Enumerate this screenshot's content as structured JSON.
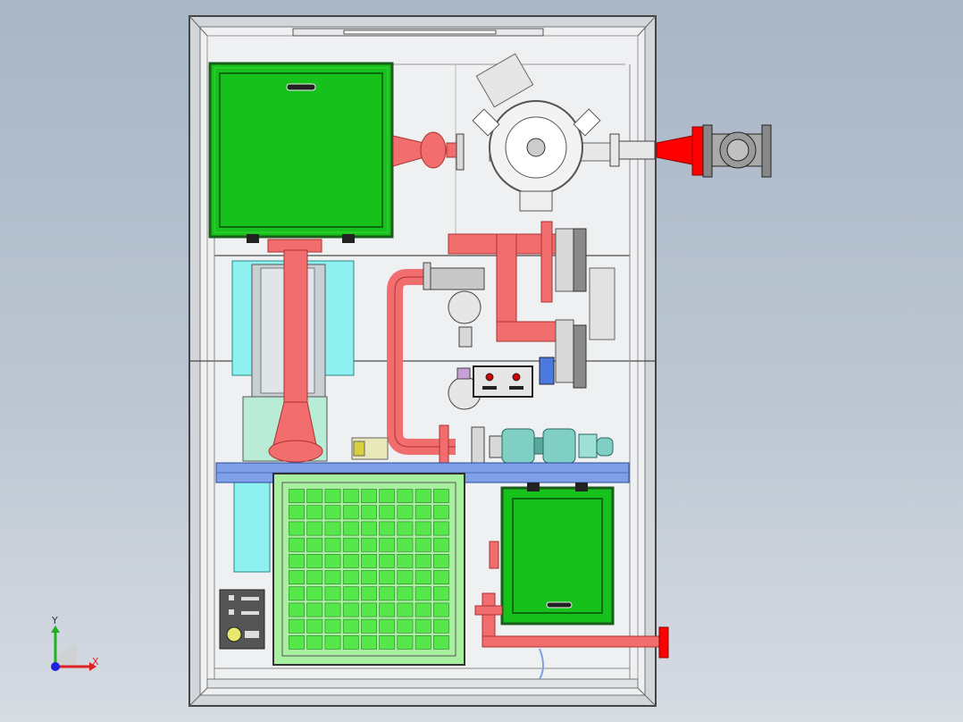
{
  "viewport": {
    "background_top": "#a9b6c6",
    "background_bottom": "#d7dce3"
  },
  "colors": {
    "cabinet_frame": "#cfd3d8",
    "cabinet_panel": "#eef0f2",
    "enclosure_green": "#16c11b",
    "enclosure_border": "#1f7a1f",
    "pipe_red": "#f26d6d",
    "pipe_hot": "#ff0000",
    "cooling_cyan": "#8ff0f0",
    "teal_pump": "#7fcfc4",
    "support_beam": "#7fa0e8",
    "grid_cell": "#a8f0a0",
    "pressure_gauge": "#e8e8b8"
  },
  "components": {
    "upper_enclosure": {
      "name": "upper-electrical-enclosure"
    },
    "lower_grille": {
      "name": "ventilation-grille",
      "rows": 10,
      "cols": 9
    },
    "lower_enclosure": {
      "name": "lower-electrical-enclosure"
    },
    "pump": {
      "name": "centrifugal-pump"
    },
    "inlet_valve": {
      "name": "inlet-gate-valve"
    },
    "outlet_flange": {
      "name": "outlet-flange"
    },
    "control_plate": {
      "name": "control-plate"
    },
    "small_panel": {
      "name": "indicator-panel"
    }
  },
  "axis_triad": {
    "x_label": "X",
    "y_label": "Y",
    "x_color": "#e02020",
    "y_color": "#20b020",
    "z_color": "#2020e0"
  }
}
